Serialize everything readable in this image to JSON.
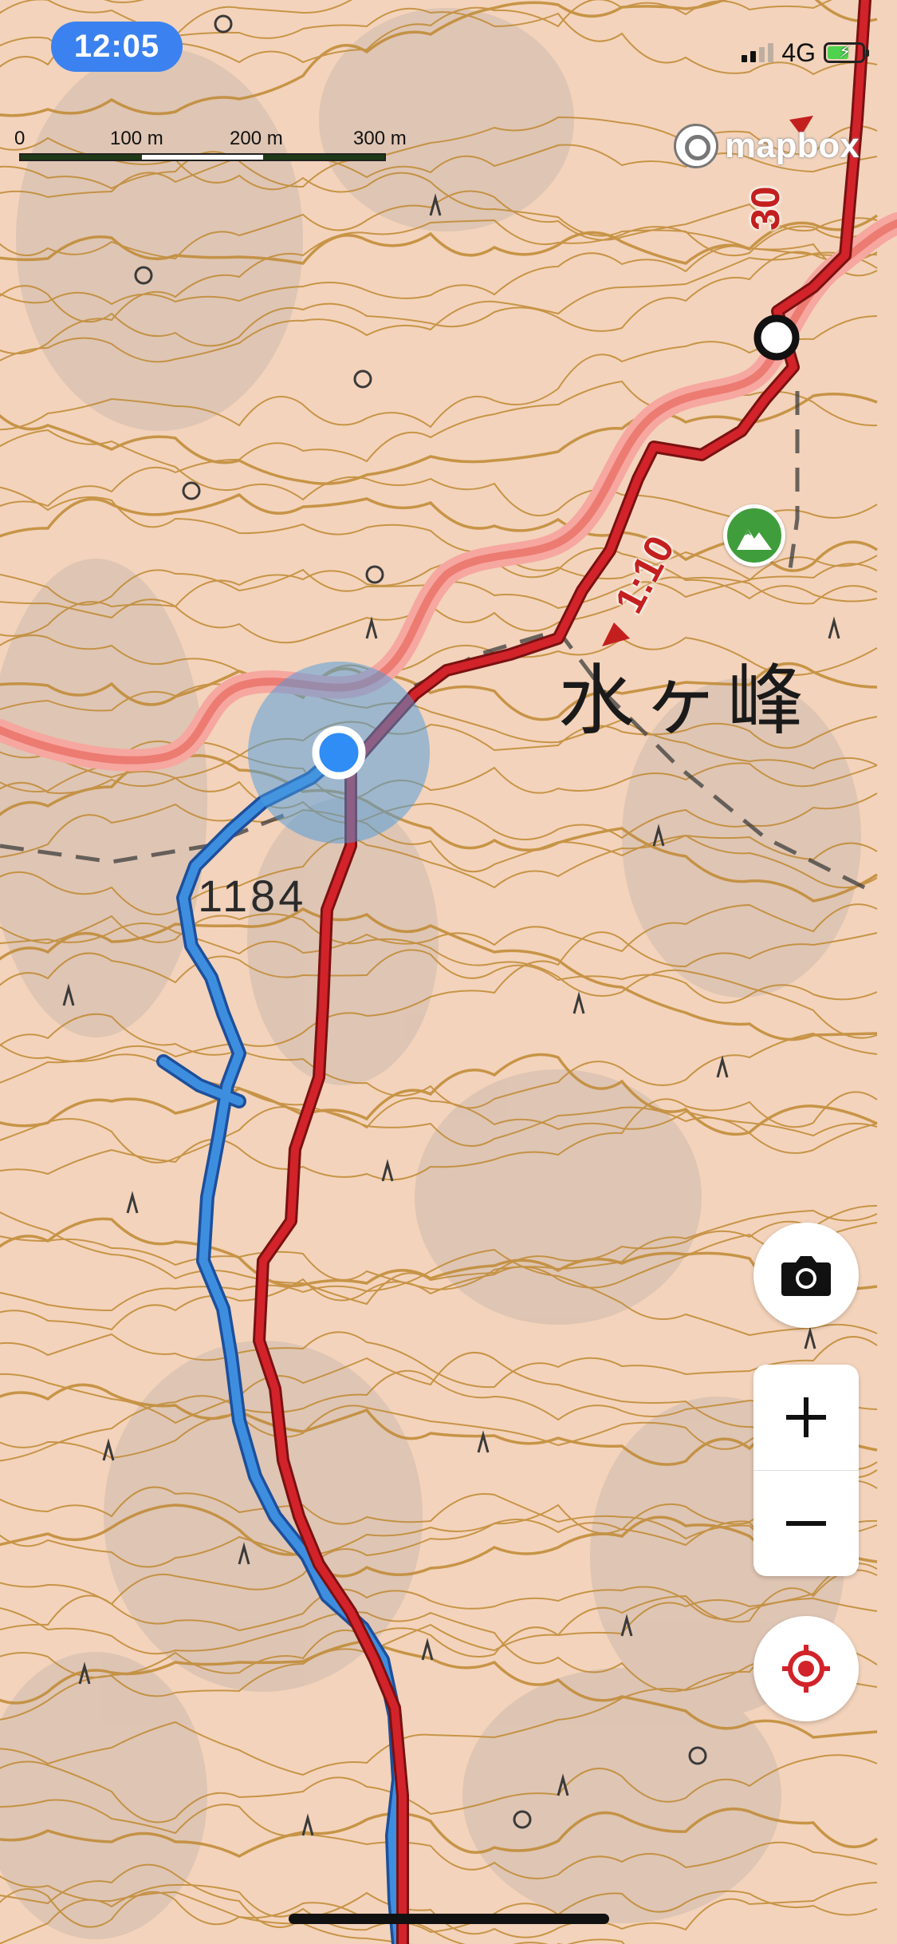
{
  "status_bar": {
    "time": "12:05",
    "network": "4G",
    "battery_level": 0.6
  },
  "scale_bar": {
    "labels": [
      "0",
      "100 m",
      "200 m",
      "300 m"
    ]
  },
  "attribution": {
    "logo_text": "mapbox"
  },
  "map": {
    "peak_name": "水ヶ峰",
    "elevation": "1184",
    "segment_times": [
      "1:10",
      "30"
    ],
    "peak_icon": "mountain-icon",
    "route_color": "#d2232a",
    "track_color": "#3e8ee0",
    "location_color": "#2f8df5"
  },
  "controls": {
    "camera_icon": "camera-icon",
    "zoom_in_icon": "plus-icon",
    "zoom_out_icon": "minus-icon",
    "locate_icon": "target-icon"
  }
}
